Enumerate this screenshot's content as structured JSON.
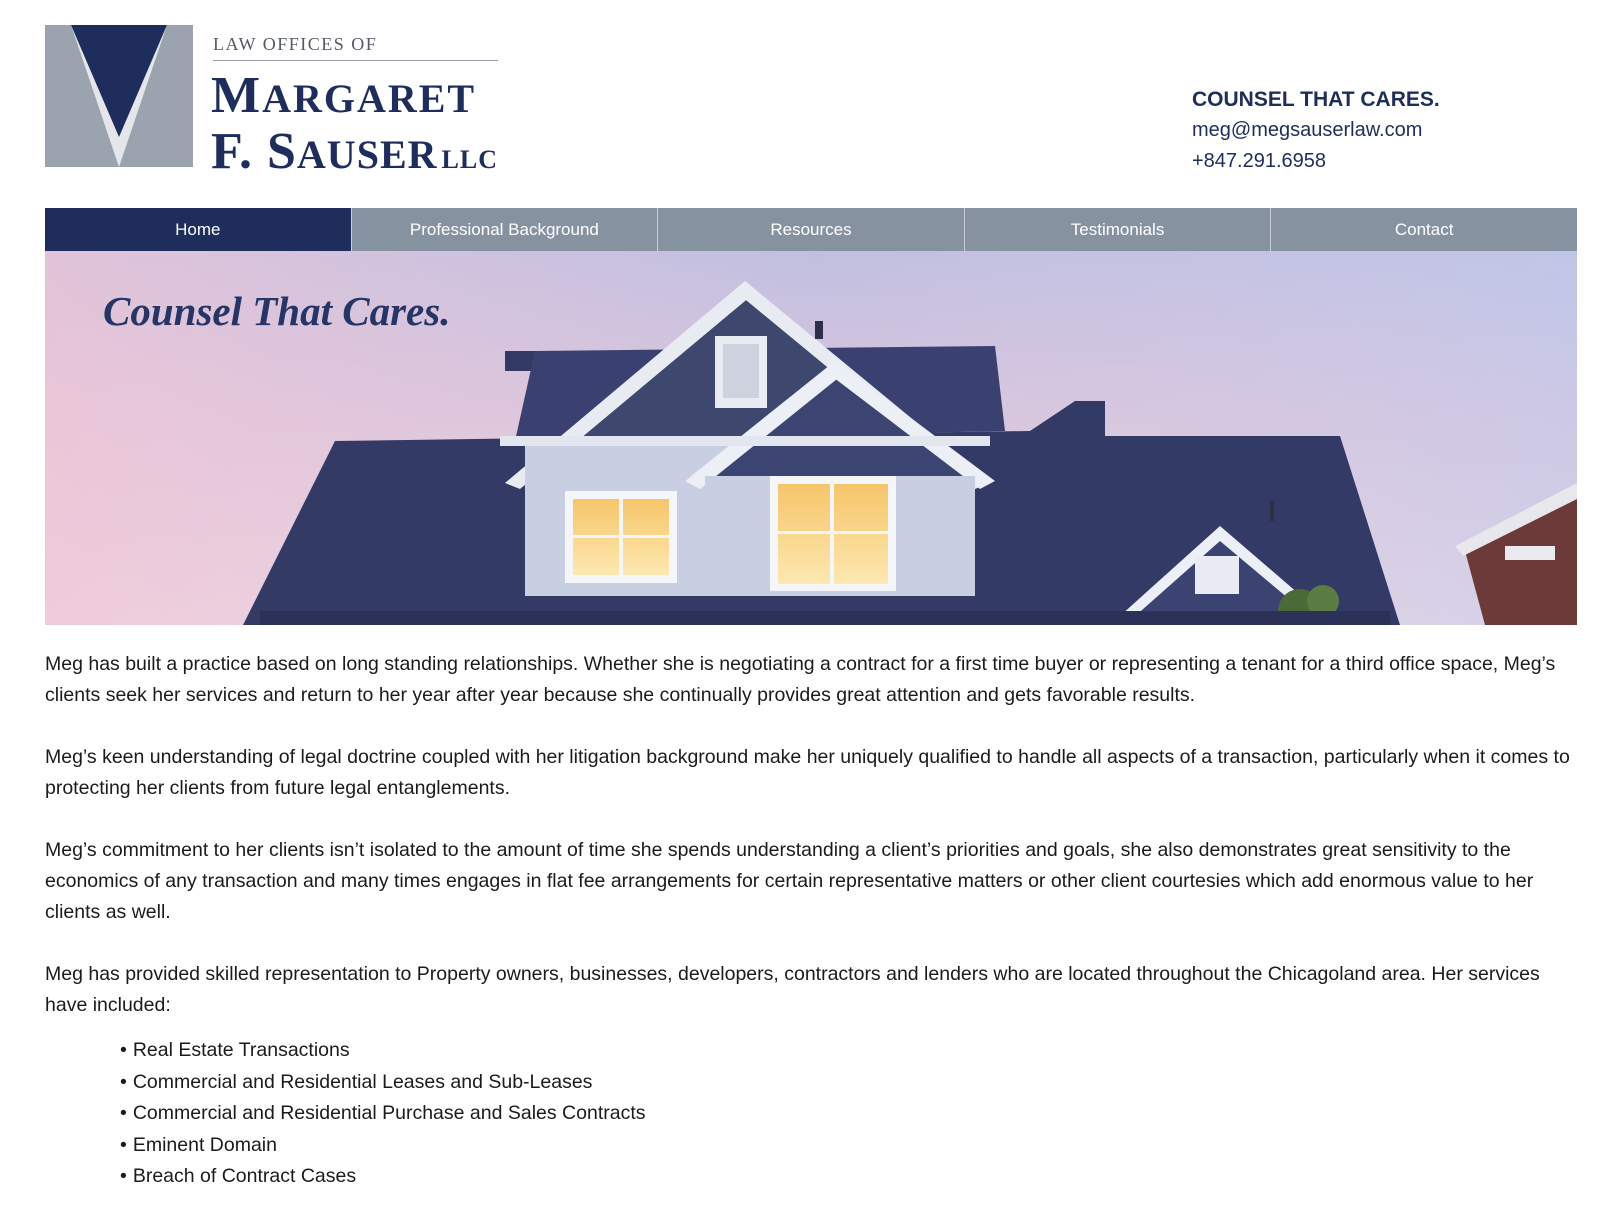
{
  "header": {
    "logo_prefix": "LAW OFFICES OF",
    "logo_name_line1_first": "M",
    "logo_name_line1_rest": "ARGARET",
    "logo_name_line2_first": "F. S",
    "logo_name_line2_rest": "AUSER",
    "logo_suffix": "LLC",
    "tagline": "COUNSEL THAT CARES.",
    "email": "meg@megsauserlaw.com",
    "phone": "+847.291.6958"
  },
  "nav": {
    "items": [
      {
        "label": "Home",
        "active": true
      },
      {
        "label": "Professional Background",
        "active": false
      },
      {
        "label": "Resources",
        "active": false
      },
      {
        "label": "Testimonials",
        "active": false
      },
      {
        "label": "Contact",
        "active": false
      }
    ]
  },
  "hero": {
    "title": "Counsel That Cares."
  },
  "content": {
    "paragraphs": [
      "Meg has built a practice based on long standing relationships. Whether she is negotiating a contract for a first time buyer or representing a tenant for a third office space, Meg’s clients seek her services and return to her year after year because she continually provides great attention and gets favorable results.",
      "Meg’s keen understanding of legal doctrine coupled with her litigation background make her uniquely qualified to handle all aspects of a transaction, particularly when it comes to protecting her clients from future legal entanglements.",
      "Meg’s commitment to her clients isn’t isolated to the amount of time she spends understanding a client’s priorities and goals, she also demonstrates great sensitivity to the economics of any transaction and many times engages in flat fee arrangements for certain representative matters or other client courtesies which add enormous value to her clients as well.",
      "Meg has provided skilled representation to Property owners, businesses, developers, contractors and lenders who are located throughout the Chicagoland area. Her services have included:"
    ],
    "bullet": "•",
    "services": [
      "Real Estate Transactions",
      "Commercial and Residential Leases and Sub-Leases",
      "Commercial and Residential Purchase and Sales Contracts",
      "Eminent Domain",
      "Breach of Contract Cases"
    ]
  },
  "colors": {
    "brand_navy": "#1e2d5c",
    "nav_gray": "#8792a1",
    "logo_gray": "#9aa3ae"
  }
}
